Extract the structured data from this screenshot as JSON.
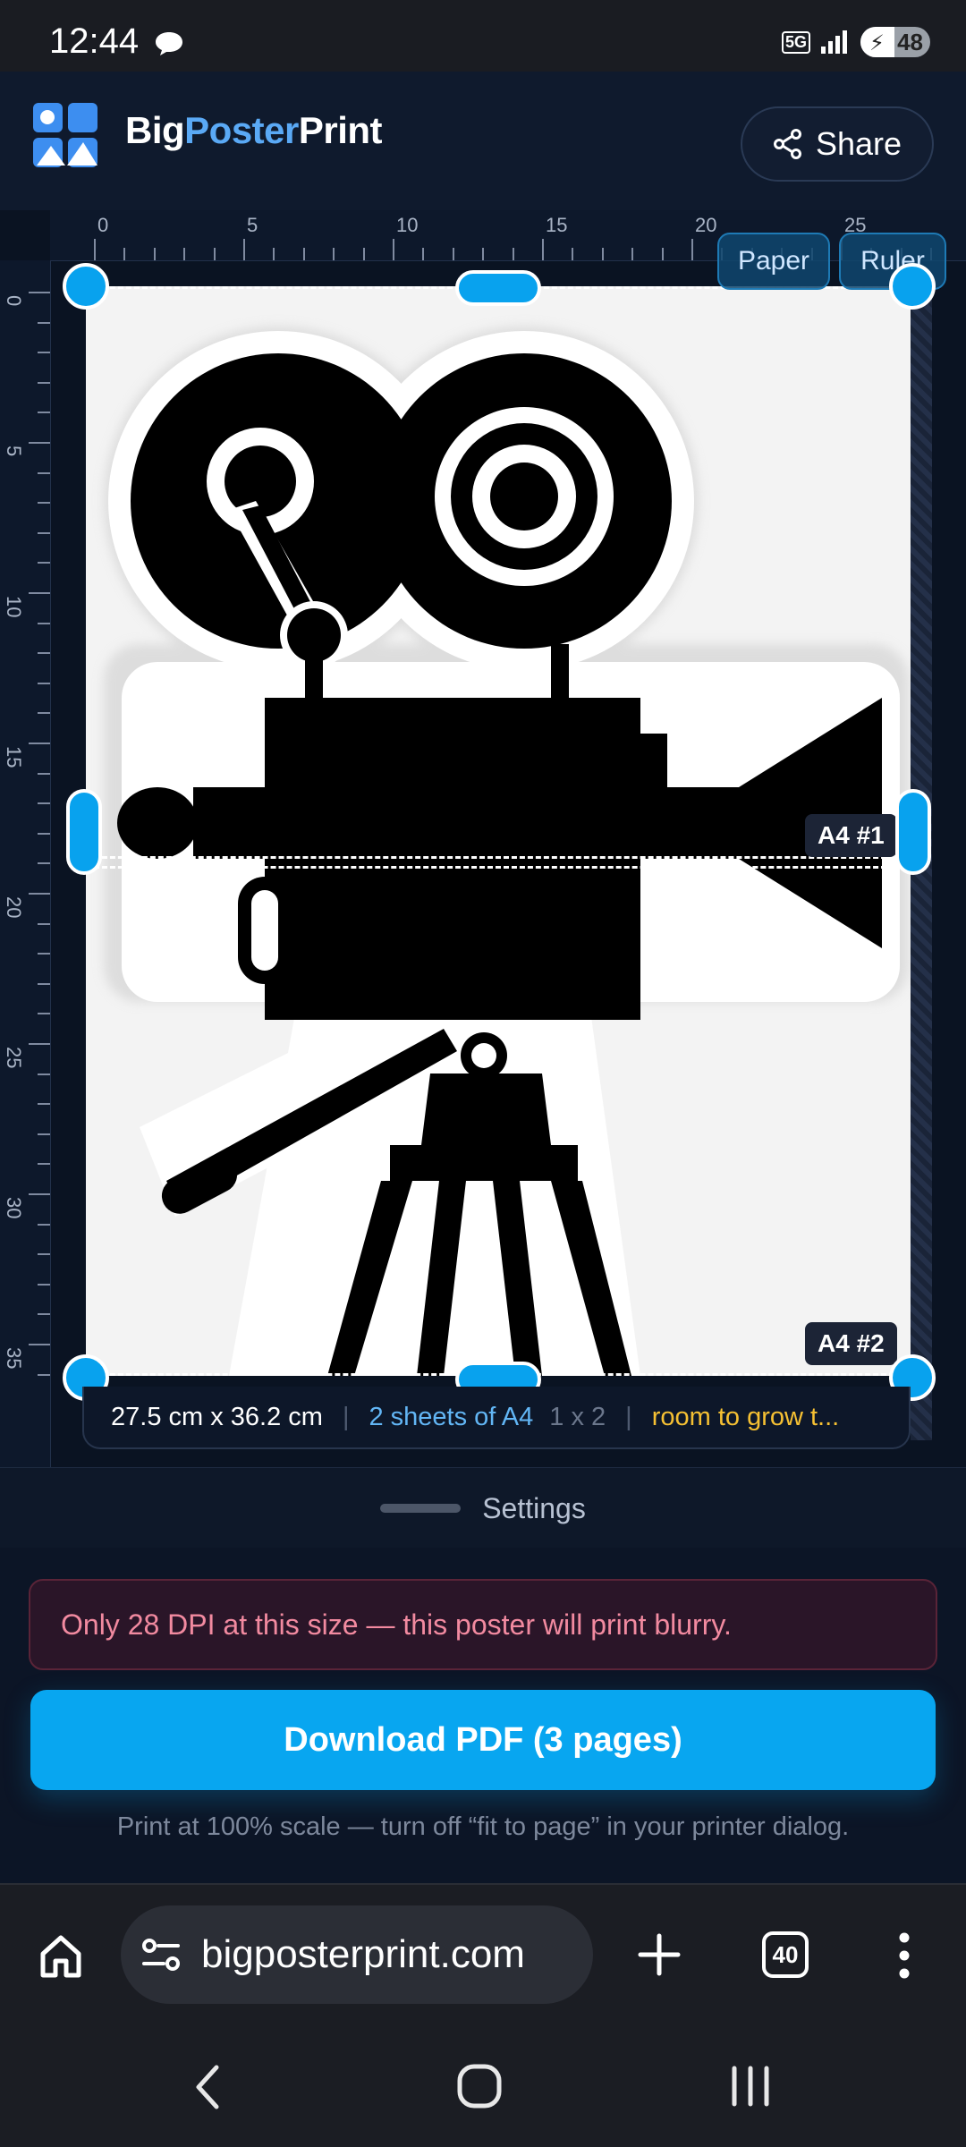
{
  "status_bar": {
    "time": "12:44",
    "network": "5G",
    "battery": "48"
  },
  "header": {
    "brand_part1": "Big",
    "brand_part2": "Poster",
    "brand_part3": "Print",
    "share_label": "Share"
  },
  "rulers": {
    "horizontal": [
      "0",
      "5",
      "10",
      "15",
      "20",
      "25"
    ],
    "vertical": [
      "0",
      "5",
      "10",
      "15",
      "20",
      "25",
      "30",
      "35"
    ]
  },
  "editor": {
    "chips": {
      "paper": "Paper",
      "ruler": "Ruler"
    },
    "sheet_labels": [
      "A4 #1",
      "A4 #2"
    ],
    "info": {
      "size": "27.5 cm x 36.2 cm",
      "sheets": "2 sheets of A4",
      "grid": "1 x 2",
      "note": "room to grow t..."
    }
  },
  "settings": {
    "label": "Settings"
  },
  "warning": {
    "text": "Only 28 DPI at this size — this poster will print blurry."
  },
  "download": {
    "label": "Download PDF (3 pages)"
  },
  "hint": {
    "text": "Print at 100% scale — turn off “fit to page” in your printer dialog."
  },
  "browser": {
    "url": "bigposterprint.com",
    "tab_count": "40"
  },
  "colors": {
    "accent": "#08a6f0",
    "brand_blue": "#5aa9f5",
    "warning_text": "#f28aa0",
    "note_yellow": "#f5c033"
  }
}
